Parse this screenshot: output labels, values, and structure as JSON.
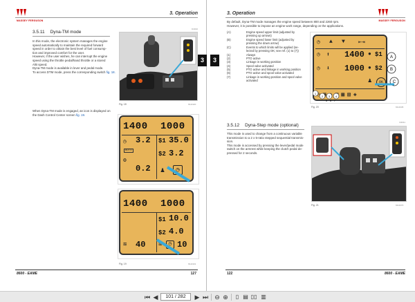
{
  "left_page": {
    "header": {
      "brand": "MASSEY FERGUSON",
      "chapter": "3. Operation"
    },
    "section_ref": "D4010",
    "section_number": "3.5.11",
    "section_title": "Dyna-TM mode",
    "paragraph_1": "In this mode, the electronic system manages the engine\nspeed automatically to maintain the required forward\nspeed in order to obtain the best level of fuel consump-\ntion and improved comfort for the user.\nHowever, if the user wishes, he can interrupt the engine\nspeed using the throttle pedal/hand throttle or a stored\nA/B speed.\nDyna-TM mode is available in lever and pedal mode.\nTo access DTM mode, press the corresponding switch",
    "paragraph_1_link": "fig. 18.",
    "fig18": {
      "caption": "Fig. 18",
      "ref": "MU2320"
    },
    "paragraph_2": "When Dyna-TM mode is engaged, an icon is displayed on\nthe Dash Control Center screen",
    "paragraph_2_link": "fig. 19.",
    "lcd1": {
      "rpm_left": "1400",
      "rpm_right": "1000",
      "row2_val": "3.2",
      "row2_s1": "$1",
      "row2_s1_val": "35.0",
      "row3_s2": "$2",
      "row3_s2_val": "3.2",
      "row4_val": "0.2",
      "auto_label": "AUTO"
    },
    "lcd2": {
      "rpm_left": "1400",
      "rpm_right": "1000",
      "s1": "$1",
      "s1_val": "10.0",
      "s2": "$2",
      "s2_val": "4.0",
      "left_val": "40",
      "right_val": "10"
    },
    "fig19": {
      "caption": "Fig. 19",
      "ref": "MU2331"
    },
    "page_number": "127"
  },
  "right_page": {
    "header": {
      "chapter": "3. Operation",
      "brand": "MASSEY FERGUSON"
    },
    "intro": "By default, Dyna-TM mode manages the engine speed between 800 and 2260 rpm.\nHowever, it is possible to impose an engine work range, depending on the applications.",
    "list": [
      {
        "key": "(A)",
        "val": "Engine speed upper limit (adjusted by"
      },
      {
        "key": "",
        "val": "pressing up arrows)"
      },
      {
        "key": "(B)",
        "val": "Engine speed lower limit (adjusted by"
      },
      {
        "key": "",
        "val": "pressing the down arrow)"
      },
      {
        "key": "(C)",
        "val": "Events to which limits will be applied (se-"
      },
      {
        "key": "",
        "val": "lected by pressing OK; see ref. (1) to (7))"
      },
      {
        "key": "(1)",
        "val": "Always"
      },
      {
        "key": "(2)",
        "val": "PTO active"
      },
      {
        "key": "(3)",
        "val": "Linkage in working position"
      },
      {
        "key": "(4)",
        "val": "Spool valve activated"
      },
      {
        "key": "(5)",
        "val": "PTO active and linkage in working position"
      },
      {
        "key": "(6)",
        "val": "PTO active and spool valve activated"
      },
      {
        "key": "(7)",
        "val": "Linkage in working position and spool valve"
      },
      {
        "key": "",
        "val": "activated"
      }
    ],
    "lcd3": {
      "rpm_top": "1400",
      "rpm_bot": "1000",
      "s1": "$1",
      "s2": "$2",
      "ok": "OK",
      "callouts": [
        "A",
        "B",
        "C",
        "1",
        "2",
        "3",
        "4",
        "5",
        "6",
        "7"
      ]
    },
    "fig20": {
      "caption": "Fig. 20",
      "ref": "MU2335"
    },
    "section2_ref": "D4011",
    "section2_number": "3.5.12",
    "section2_title": "Dyna-Step mode (optional)",
    "section2_text": "This mode is used to change from a continuous variable\ntransmission to a 2 x 5-ratio stepped sequential transmis-\nsion.\nThis mode is accessed by pressing the lever/pedal mode\nswitch on the armrest while keeping the clutch pedal de-\npressed for 2 seconds.",
    "fig21": {
      "caption": "Fig. 21",
      "ref": "MU2370"
    },
    "page_number": "122",
    "model": "8600 - EAME"
  },
  "left_footer_model": "8600 - EAME",
  "toolbar": {
    "page_value": "101 / 282",
    "icons": [
      "first-page-icon",
      "prev-page-icon",
      "next-page-icon",
      "last-page-icon",
      "back-icon",
      "forward-icon",
      "single-page-icon",
      "continuous-icon",
      "two-page-icon",
      "two-page-continuous-icon"
    ]
  },
  "colors": {
    "lcd_bg": "#e8b55a",
    "brand_red": "#cc0000",
    "link_blue": "#1a5fb4"
  }
}
